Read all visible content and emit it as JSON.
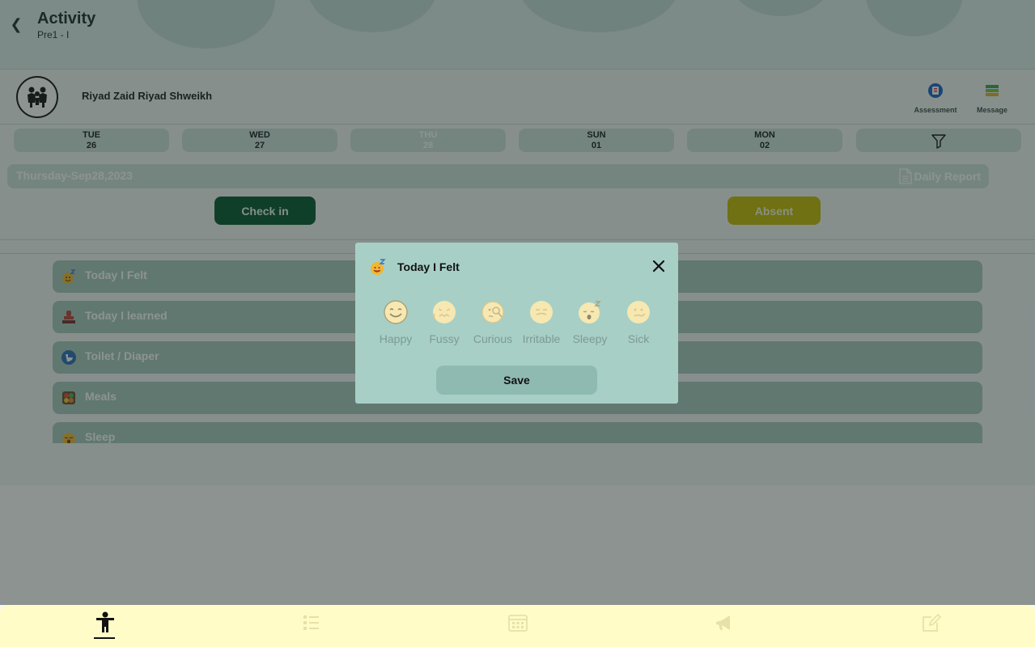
{
  "header": {
    "title": "Activity",
    "subtitle": "Pre1 - I"
  },
  "student": {
    "name": "Riyad Zaid Riyad Shweikh"
  },
  "top_actions": [
    {
      "label": "Assessment",
      "icon": "assessment-icon"
    },
    {
      "label": "Message",
      "icon": "message-icon"
    }
  ],
  "days": [
    {
      "name": "TUE",
      "date": "26"
    },
    {
      "name": "WED",
      "date": "27"
    },
    {
      "name": "THU",
      "date": "28",
      "active": true
    },
    {
      "name": "SUN",
      "date": "01"
    },
    {
      "name": "MON",
      "date": "02"
    }
  ],
  "date_bar": {
    "date": "Thursday-Sep28,2023",
    "report_label": "Daily Report"
  },
  "buttons": {
    "check_in": "Check in",
    "absent": "Absent"
  },
  "activities": [
    {
      "label": "Today I Felt",
      "icon": "mood-face-icon"
    },
    {
      "label": "Today I learned",
      "icon": "stamp-icon"
    },
    {
      "label": "Toilet / Diaper",
      "icon": "toilet-icon"
    },
    {
      "label": "Meals",
      "icon": "meals-icon"
    },
    {
      "label": "Sleep",
      "icon": "sleep-icon"
    }
  ],
  "modal": {
    "title": "Today I Felt",
    "save_label": "Save",
    "moods": [
      {
        "label": "Happy",
        "icon": "happy-face-icon"
      },
      {
        "label": "Fussy",
        "icon": "fussy-face-icon"
      },
      {
        "label": "Curious",
        "icon": "curious-face-icon"
      },
      {
        "label": "Irritable",
        "icon": "irritable-face-icon"
      },
      {
        "label": "Sleepy",
        "icon": "sleepy-face-icon"
      },
      {
        "label": "Sick",
        "icon": "sick-face-icon"
      }
    ]
  },
  "bottom_nav": [
    {
      "icon": "child-activity-icon",
      "active": true
    },
    {
      "icon": "checklist-icon"
    },
    {
      "icon": "calendar-icon"
    },
    {
      "icon": "megaphone-icon"
    },
    {
      "icon": "edit-note-icon"
    }
  ],
  "colors": {
    "check_in": "#07572f",
    "absent": "#c4bb02",
    "modal_bg": "#a7cfc6",
    "bottom_nav_bg": "#fffcc7"
  }
}
